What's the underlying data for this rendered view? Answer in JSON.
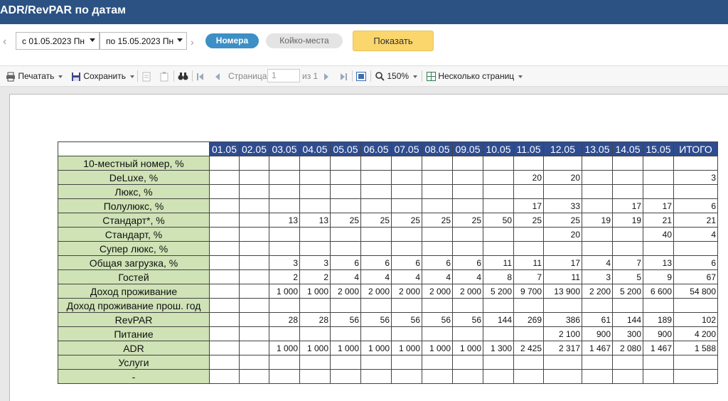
{
  "title": "ADR/RevPAR по датам",
  "filter": {
    "date_from": "с 01.05.2023 Пн",
    "date_to": "по 15.05.2023 Пн",
    "mode_active": "Номера",
    "mode_inactive": "Койко-места",
    "show_label": "Показать"
  },
  "toolbar": {
    "print": "Печатать",
    "save": "Сохранить",
    "page_label": "Страница",
    "page_value": "1",
    "page_of": "из 1",
    "zoom": "150%",
    "multi_page": "Несколько страниц"
  },
  "colors": {
    "header_blue": "#2e4c8f",
    "label_green": "#cfe3b6",
    "title_bar": "#2b5283",
    "show_button": "#fbd66d",
    "active_pill": "#3d8fc6"
  },
  "report": {
    "columns": [
      "01.05",
      "02.05",
      "03.05",
      "04.05",
      "05.05",
      "06.05",
      "07.05",
      "08.05",
      "09.05",
      "10.05",
      "11.05",
      "12.05",
      "13.05",
      "14.05",
      "15.05",
      "ИТОГО"
    ],
    "rows": [
      {
        "label": "10-местный номер, %",
        "values": [
          "",
          "",
          "",
          "",
          "",
          "",
          "",
          "",
          "",
          "",
          "",
          "",
          "",
          "",
          "",
          ""
        ]
      },
      {
        "label": "DeLuxe, %",
        "values": [
          "",
          "",
          "",
          "",
          "",
          "",
          "",
          "",
          "",
          "",
          "20",
          "20",
          "",
          "",
          "",
          "3"
        ]
      },
      {
        "label": "Люкс, %",
        "values": [
          "",
          "",
          "",
          "",
          "",
          "",
          "",
          "",
          "",
          "",
          "",
          "",
          "",
          "",
          "",
          ""
        ]
      },
      {
        "label": "Полулюкс, %",
        "values": [
          "",
          "",
          "",
          "",
          "",
          "",
          "",
          "",
          "",
          "",
          "17",
          "33",
          "",
          "17",
          "17",
          "6"
        ]
      },
      {
        "label": "Стандарт*, %",
        "values": [
          "",
          "",
          "13",
          "13",
          "25",
          "25",
          "25",
          "25",
          "25",
          "50",
          "25",
          "25",
          "19",
          "19",
          "21",
          "21"
        ]
      },
      {
        "label": "Стандарт, %",
        "values": [
          "",
          "",
          "",
          "",
          "",
          "",
          "",
          "",
          "",
          "",
          "",
          "20",
          "",
          "",
          "40",
          "4"
        ]
      },
      {
        "label": "Супер люкс, %",
        "values": [
          "",
          "",
          "",
          "",
          "",
          "",
          "",
          "",
          "",
          "",
          "",
          "",
          "",
          "",
          "",
          ""
        ]
      },
      {
        "label": "Общая загрузка, %",
        "values": [
          "",
          "",
          "3",
          "3",
          "6",
          "6",
          "6",
          "6",
          "6",
          "11",
          "11",
          "17",
          "4",
          "7",
          "13",
          "6"
        ]
      },
      {
        "label": "Гостей",
        "values": [
          "",
          "",
          "2",
          "2",
          "4",
          "4",
          "4",
          "4",
          "4",
          "8",
          "7",
          "11",
          "3",
          "5",
          "9",
          "67"
        ]
      },
      {
        "label": "Доход проживание",
        "values": [
          "",
          "",
          "1 000",
          "1 000",
          "2 000",
          "2 000",
          "2 000",
          "2 000",
          "2 000",
          "5 200",
          "9 700",
          "13 900",
          "2 200",
          "5 200",
          "6 600",
          "54 800"
        ]
      },
      {
        "label": "Доход проживание прош. год",
        "values": [
          "",
          "",
          "",
          "",
          "",
          "",
          "",
          "",
          "",
          "",
          "",
          "",
          "",
          "",
          "",
          ""
        ]
      },
      {
        "label": "RevPAR",
        "values": [
          "",
          "",
          "28",
          "28",
          "56",
          "56",
          "56",
          "56",
          "56",
          "144",
          "269",
          "386",
          "61",
          "144",
          "189",
          "102"
        ]
      },
      {
        "label": "Питание",
        "values": [
          "",
          "",
          "",
          "",
          "",
          "",
          "",
          "",
          "",
          "",
          "",
          "2 100",
          "900",
          "300",
          "900",
          "4 200"
        ]
      },
      {
        "label": "ADR",
        "values": [
          "",
          "",
          "1 000",
          "1 000",
          "1 000",
          "1 000",
          "1 000",
          "1 000",
          "1 000",
          "1 300",
          "2 425",
          "2 317",
          "1 467",
          "2 080",
          "1 467",
          "1 588"
        ]
      },
      {
        "label": "Услуги",
        "values": [
          "",
          "",
          "",
          "",
          "",
          "",
          "",
          "",
          "",
          "",
          "",
          "",
          "",
          "",
          "",
          ""
        ]
      },
      {
        "label": "-",
        "values": [
          "",
          "",
          "",
          "",
          "",
          "",
          "",
          "",
          "",
          "",
          "",
          "",
          "",
          "",
          "",
          ""
        ]
      }
    ]
  }
}
